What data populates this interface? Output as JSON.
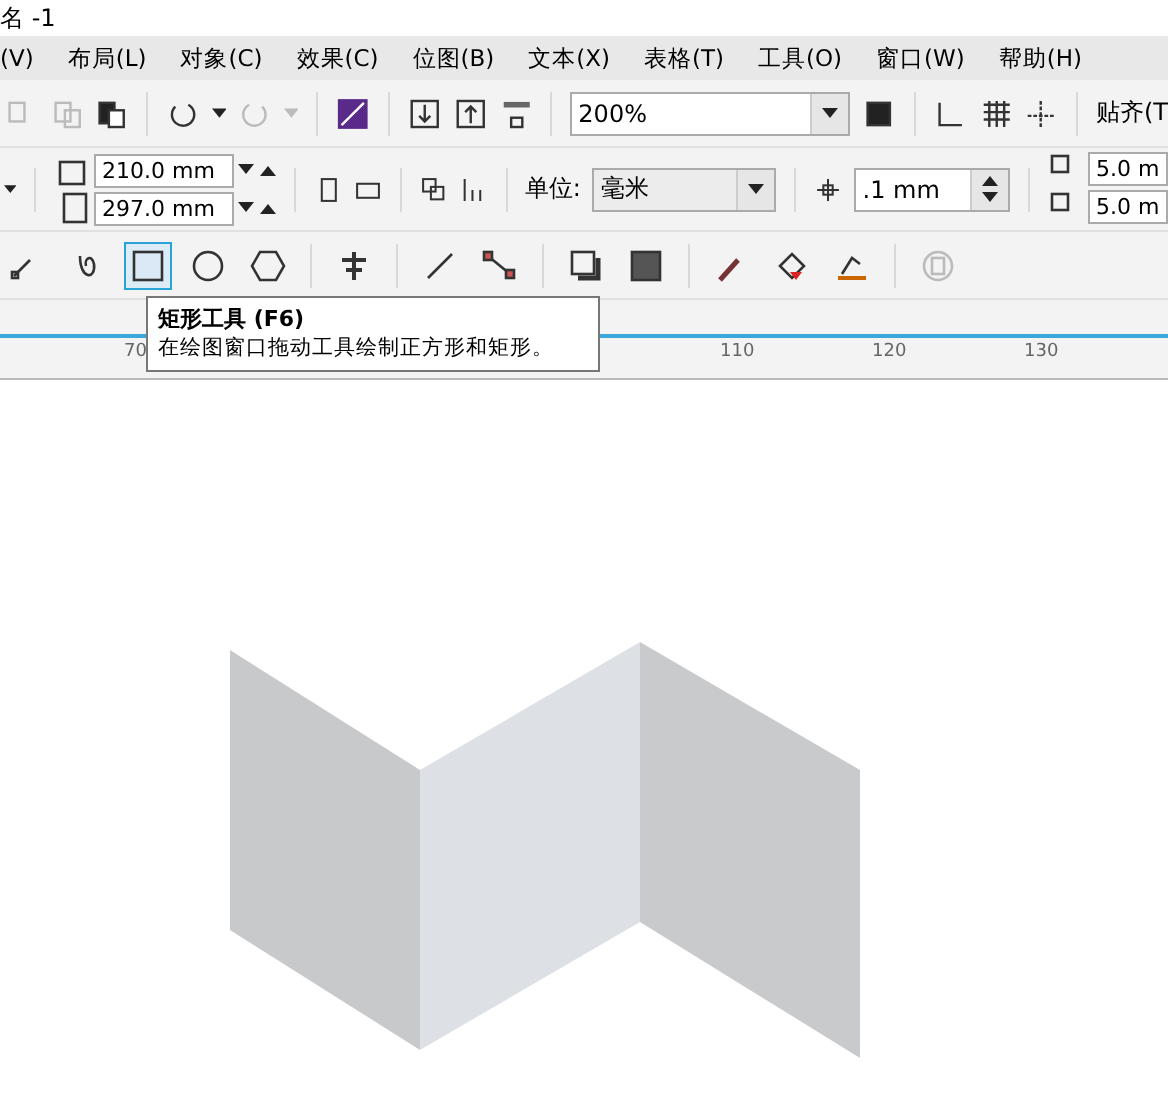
{
  "window": {
    "title": "名 -1"
  },
  "menu": [
    "(V)",
    "布局(L)",
    "对象(C)",
    "效果(C)",
    "位图(B)",
    "文本(X)",
    "表格(T)",
    "工具(O)",
    "窗口(W)",
    "帮助(H)"
  ],
  "toolbar": {
    "zoom": "200%",
    "snap": "贴齐(T"
  },
  "property_bar": {
    "width": "210.0 mm",
    "height": "297.0 mm",
    "unit_label": "单位:",
    "unit": "毫米",
    "nudge": ".1 mm",
    "dup_x": "5.0 m",
    "dup_y": "5.0 m"
  },
  "toolbox": [
    {
      "selected": false
    },
    {
      "selected": false
    },
    {
      "selected": true
    },
    {
      "selected": false
    },
    {
      "selected": false
    },
    {
      "selected": false
    },
    {
      "selected": false
    },
    {
      "selected": false
    },
    {
      "selected": false
    },
    {
      "selected": false
    },
    {
      "selected": false
    },
    {
      "selected": false
    },
    {
      "selected": false
    },
    {
      "selected": false
    }
  ],
  "tooltip": {
    "title": "矩形工具 (F6)",
    "text": "在绘图窗口拖动工具绘制正方形和矩形。"
  },
  "ruler": {
    "ticks": [
      "70",
      "110",
      "120",
      "130"
    ]
  }
}
